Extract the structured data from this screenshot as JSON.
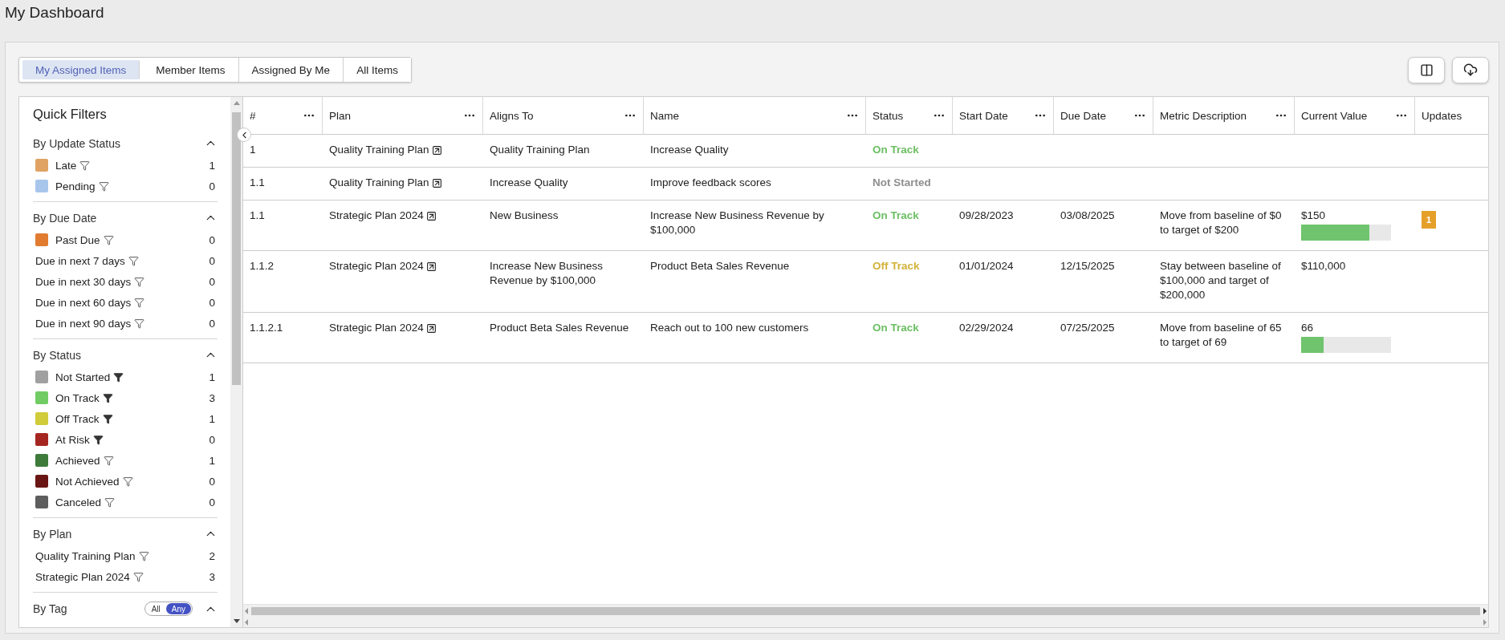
{
  "page_title": "My Dashboard",
  "tabs": [
    {
      "label": "My Assigned Items",
      "selected": true
    },
    {
      "label": "Member Items",
      "selected": false
    },
    {
      "label": "Assigned By Me",
      "selected": false
    },
    {
      "label": "All Items",
      "selected": false
    }
  ],
  "quick_filters": {
    "title": "Quick Filters",
    "sections": [
      {
        "title": "By Update Status",
        "expanded": true,
        "items": [
          {
            "label": "Late",
            "count": "1",
            "color": "#e0a364",
            "filter_active": false
          },
          {
            "label": "Pending",
            "count": "0",
            "color": "#a8c6ec",
            "filter_active": false
          }
        ]
      },
      {
        "title": "By Due Date",
        "expanded": true,
        "items": [
          {
            "label": "Past Due",
            "count": "0",
            "color": "#e07b30",
            "filter_active": false
          },
          {
            "label": "Due in next 7 days",
            "count": "0",
            "filter_active": false
          },
          {
            "label": "Due in next 30 days",
            "count": "0",
            "filter_active": false
          },
          {
            "label": "Due in next 60 days",
            "count": "0",
            "filter_active": false
          },
          {
            "label": "Due in next 90 days",
            "count": "0",
            "filter_active": false
          }
        ]
      },
      {
        "title": "By Status",
        "expanded": true,
        "items": [
          {
            "label": "Not Started",
            "count": "1",
            "color": "#a0a0a0",
            "filter_active": true
          },
          {
            "label": "On Track",
            "count": "3",
            "color": "#72cc64",
            "filter_active": true
          },
          {
            "label": "Off Track",
            "count": "1",
            "color": "#d0cc3a",
            "filter_active": true
          },
          {
            "label": "At Risk",
            "count": "0",
            "color": "#a52620",
            "filter_active": true
          },
          {
            "label": "Achieved",
            "count": "1",
            "color": "#3e7a3a",
            "filter_active": false
          },
          {
            "label": "Not Achieved",
            "count": "0",
            "color": "#6a1614",
            "filter_active": false
          },
          {
            "label": "Canceled",
            "count": "0",
            "color": "#5e5e5e",
            "filter_active": false
          }
        ]
      },
      {
        "title": "By Plan",
        "expanded": true,
        "items": [
          {
            "label": "Quality Training Plan",
            "count": "2",
            "filter_active": false
          },
          {
            "label": "Strategic Plan 2024",
            "count": "3",
            "filter_active": false
          }
        ]
      },
      {
        "title": "By Tag",
        "expanded": true,
        "toggle": [
          {
            "label": "All",
            "selected": false
          },
          {
            "label": "Any",
            "selected": true
          }
        ]
      }
    ]
  },
  "table": {
    "columns": [
      "#",
      "Plan",
      "Aligns To",
      "Name",
      "Status",
      "Start Date",
      "Due Date",
      "Metric Description",
      "Current Value",
      "Updates"
    ],
    "rows": [
      {
        "number": "1",
        "plan": "Quality Training Plan",
        "aligns_to": "Quality Training Plan",
        "name": "Increase Quality",
        "status": {
          "label": "On Track",
          "kind": "on_track"
        }
      },
      {
        "number": "1.1",
        "plan": "Quality Training Plan",
        "aligns_to": "Increase Quality",
        "name": "Improve feedback scores",
        "status": {
          "label": "Not Started",
          "kind": "not_started"
        }
      },
      {
        "number": "1.1",
        "plan": "Strategic Plan 2024",
        "aligns_to": "New Business",
        "name": "Increase New Business Revenue by $100,000",
        "status": {
          "label": "On Track",
          "kind": "on_track"
        },
        "start_date": "09/28/2023",
        "due_date": "03/08/2025",
        "metric_description": "Move from baseline of $0 to target of $200",
        "current_value": "$150",
        "level": 0.76,
        "updates": "1"
      },
      {
        "number": "1.1.2",
        "plan": "Strategic Plan 2024",
        "aligns_to": "Increase New Business Revenue by $100,000",
        "name": "Product Beta Sales Revenue",
        "status": {
          "label": "Off Track",
          "kind": "off_track"
        },
        "start_date": "01/01/2024",
        "due_date": "12/15/2025",
        "metric_description": "Stay between baseline of $100,000 and target of $200,000",
        "current_value": "$110,000"
      },
      {
        "number": "1.1.2.1",
        "plan": "Strategic Plan 2024",
        "aligns_to": "Product Beta Sales Revenue",
        "name": "Reach out to 100 new customers",
        "status": {
          "label": "On Track",
          "kind": "on_track"
        },
        "start_date": "02/29/2024",
        "due_date": "07/25/2025",
        "metric_description": "Move from baseline of 65 to target of 69",
        "current_value": "66",
        "level": 0.25
      }
    ]
  }
}
